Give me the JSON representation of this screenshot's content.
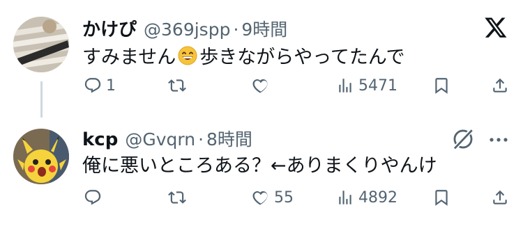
{
  "tweets": [
    {
      "author": "かけぴ",
      "handle": "@369jspp",
      "separator": "·",
      "time": "9時間",
      "text_before_emoji": "すみません",
      "emoji": "grinning-face-with-smiling-eyes",
      "text_after_emoji": "歩きながらやってたんで",
      "reply_count": "1",
      "retweet_count": "",
      "like_count": "",
      "view_count": "5471"
    },
    {
      "author": "kcp",
      "handle": "@Gvqrn",
      "separator": "·",
      "time": "8時間",
      "text": "俺に悪いところある？←ありまくりやんけ",
      "reply_count": "",
      "retweet_count": "",
      "like_count": "55",
      "view_count": "4892"
    }
  ],
  "colors": {
    "text": "#0f1419",
    "secondary": "#536471",
    "thread_line": "#cfd9de"
  },
  "icons": [
    "reply-icon",
    "retweet-icon",
    "like-icon",
    "views-icon",
    "bookmark-icon",
    "share-icon",
    "x-logo-icon",
    "grok-icon",
    "more-icon"
  ]
}
